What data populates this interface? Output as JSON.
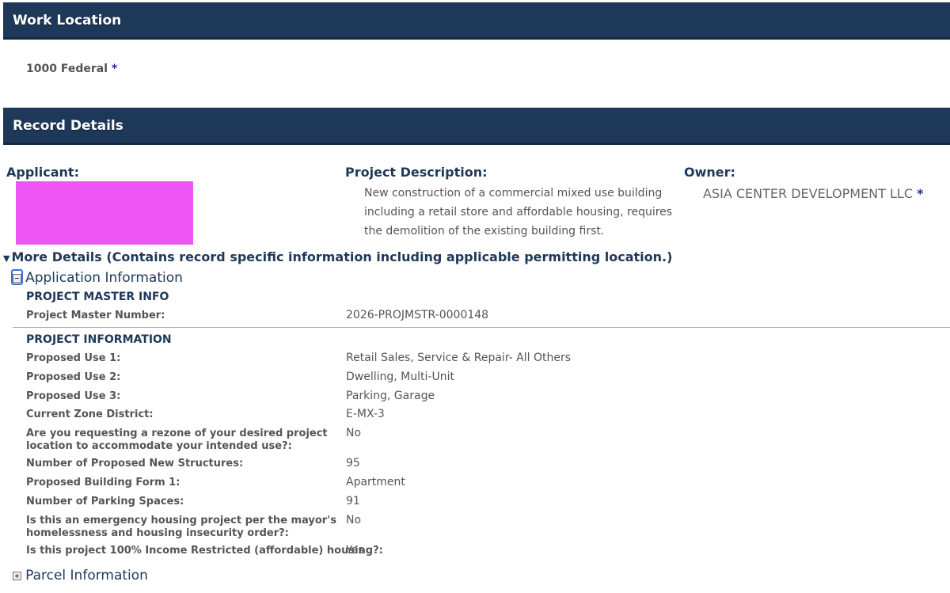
{
  "work_location": {
    "title": "Work Location",
    "address": "1000 Federal",
    "required_marker": "*"
  },
  "record_details": {
    "title": "Record Details",
    "applicant_label": "Applicant:",
    "project_description_label": "Project Description:",
    "project_description": "New construction of a commercial mixed use building including a retail store and affordable housing, requires the demolition of the existing building first.",
    "owner_label": "Owner:",
    "owner_name": "ASIA CENTER DEVELOPMENT LLC",
    "owner_marker": "*"
  },
  "more_details": {
    "label": "More Details (Contains record specific information including applicable permitting location.)"
  },
  "application_information": {
    "title": "Application Information",
    "project_master_info": {
      "title": "PROJECT MASTER INFO",
      "rows": [
        {
          "label": "Project Master Number:",
          "value": "2026-PROJMSTR-0000148"
        }
      ]
    },
    "project_information": {
      "title": "PROJECT INFORMATION",
      "rows": [
        {
          "label": "Proposed Use 1:",
          "value": "Retail Sales, Service & Repair- All Others"
        },
        {
          "label": "Proposed Use 2:",
          "value": "Dwelling, Multi-Unit"
        },
        {
          "label": "Proposed Use 3:",
          "value": "Parking, Garage"
        },
        {
          "label": "Current Zone District:",
          "value": "E-MX-3"
        },
        {
          "label": "Are you requesting a rezone of your desired project location to accommodate your intended use?:",
          "value": "No"
        },
        {
          "label": "Number of Proposed New Structures:",
          "value": "95"
        },
        {
          "label": "Proposed Building Form 1:",
          "value": "Apartment"
        },
        {
          "label": "Number of Parking Spaces:",
          "value": "91"
        },
        {
          "label": "Is this an emergency housing project per the mayor's homelessness and housing insecurity order?:",
          "value": "No"
        },
        {
          "label": "Is this project 100% Income Restricted (affordable) housing?:",
          "value": "Yes"
        }
      ]
    }
  },
  "parcel_information": {
    "title": "Parcel Information"
  },
  "colors": {
    "header_bar": "#1e3859",
    "heading_text": "#1e3859",
    "redaction": "#ee55f5",
    "required_marker": "#1a2f8f"
  }
}
